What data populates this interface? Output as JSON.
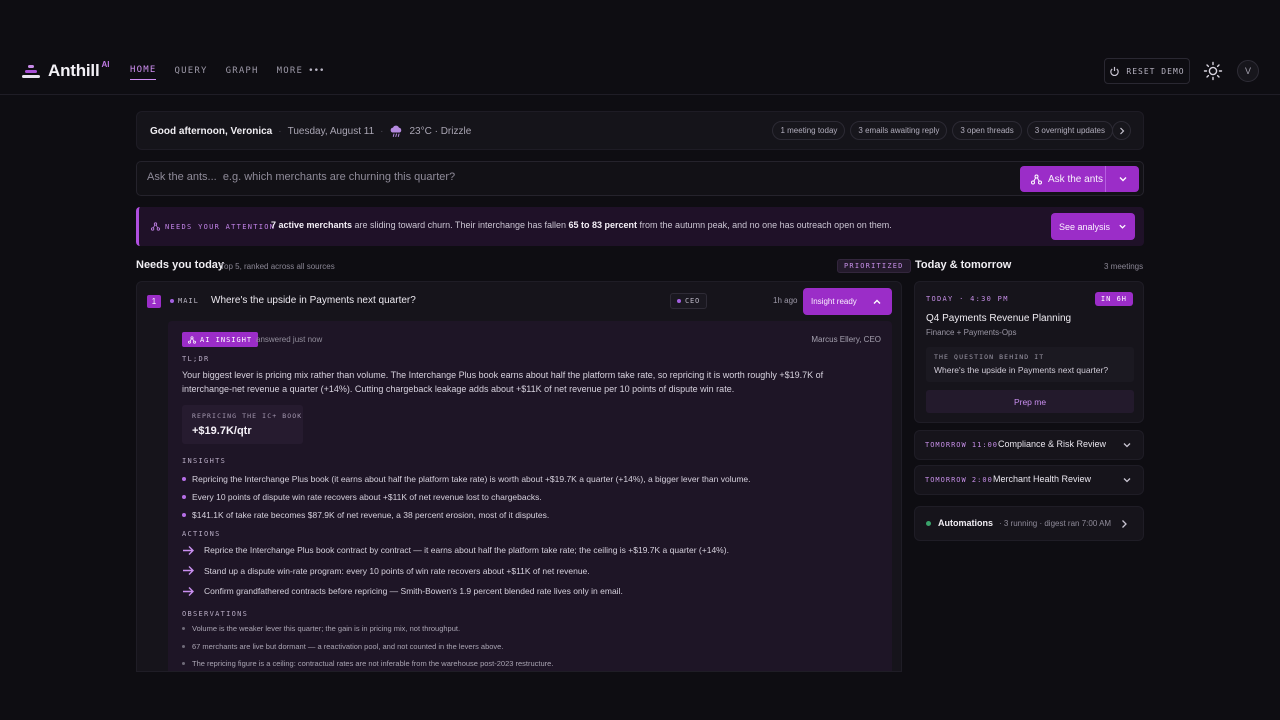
{
  "app": {
    "name": "Anthill",
    "sup": "AI",
    "colors": {
      "accent": "#9b2dc8",
      "accent_light": "#cf8ff2",
      "background": "#0e0d12",
      "automation_ok": "#3aa36b"
    }
  },
  "nav": {
    "items": [
      {
        "label": "HOME",
        "active": true
      },
      {
        "label": "QUERY"
      },
      {
        "label": "GRAPH"
      },
      {
        "label": "MORE"
      }
    ],
    "more_icon": "ellipsis-icon",
    "more_glyph": "•••",
    "reset_label": "RESET DEMO",
    "avatar_initial": "V"
  },
  "greeting": {
    "hello": "Good afternoon, Veronica",
    "date": "Tuesday, August 11",
    "weather": "23°C · Drizzle",
    "weather_icon": "rain-cloud-icon",
    "sep": "·",
    "chips": [
      "1 meeting today",
      "3 emails awaiting reply",
      "3 open threads",
      "3 overnight updates"
    ]
  },
  "ask": {
    "placeholder": "Ask the ants...  e.g. which merchants are churning this quarter?",
    "button": "Ask the ants"
  },
  "attention": {
    "label": "NEEDS YOUR ATTENTION",
    "bold1": "7 active merchants",
    "text1": " are sliding toward churn. Their interchange has fallen ",
    "bold2": "65 to 83 percent",
    "text2": " from the autumn peak, and no one has outreach open on them.",
    "button": "See analysis"
  },
  "needs": {
    "title": "Needs you today",
    "subtitle": "Top 5, ranked across all sources",
    "badge": "PRIORITIZED",
    "item": {
      "number": "1",
      "source": "MAIL",
      "title": "Where's the upside in Payments next quarter?",
      "tag": "CEO",
      "ago": "1h ago",
      "button": "Insight ready"
    },
    "insight": {
      "badge": "AI INSIGHT",
      "answered": "answered just now",
      "author": "Marcus Ellery, CEO",
      "tldr_label": "TL;DR",
      "tldr": "Your biggest lever is pricing mix rather than volume. The Interchange Plus book earns about half the platform take rate, so repricing it is worth roughly +$19.7K of interchange-net revenue a quarter (+14%). Cutting chargeback leakage adds about +$11K of net revenue per 10 points of dispute win rate.",
      "metric_label": "REPRICING THE IC+ BOOK",
      "metric_value": "+$19.7K/qtr",
      "insights_label": "INSIGHTS",
      "insights": [
        "Repricing the Interchange Plus book (it earns about half the platform take rate) is worth about +$19.7K a quarter (+14%), a bigger lever than volume.",
        "Every 10 points of dispute win rate recovers about +$11K of net revenue lost to chargebacks.",
        "$141.1K of take rate becomes $87.9K of net revenue, a 38 percent erosion, most of it disputes."
      ],
      "actions_label": "ACTIONS",
      "actions": [
        "Reprice the Interchange Plus book contract by contract — it earns about half the platform take rate; the ceiling is +$19.7K a quarter (+14%).",
        "Stand up a dispute win-rate program: every 10 points of win rate recovers about +$11K of net revenue.",
        "Confirm grandfathered contracts before repricing — Smith-Bowen's 1.9 percent blended rate lives only in email."
      ],
      "observations_label": "OBSERVATIONS",
      "observations": [
        "Volume is the weaker lever this quarter; the gain is in pricing mix, not throughput.",
        "67 merchants are live but dormant — a reactivation pool, and not counted in the levers above.",
        "The repricing figure is a ceiling: contractual rates are not inferable from the warehouse post-2023 restructure."
      ]
    }
  },
  "today": {
    "title": "Today & tomorrow",
    "count": "3 meetings",
    "next": {
      "when": "TODAY · 4:30 PM",
      "badge": "IN 6H",
      "title": "Q4 Payments Revenue Planning",
      "team": "Finance + Payments-Ops",
      "question_label": "THE QUESTION BEHIND IT",
      "question": "Where's the upside in Payments next quarter?",
      "prep": "Prep me"
    },
    "later": [
      {
        "when": "TOMORROW 11:00",
        "title": "Compliance & Risk Review"
      },
      {
        "when": "TOMORROW 2:00",
        "title": "Merchant Health Review"
      }
    ],
    "automations": {
      "title": "Automations",
      "status": "· 3 running · digest ran 7:00 AM"
    }
  }
}
